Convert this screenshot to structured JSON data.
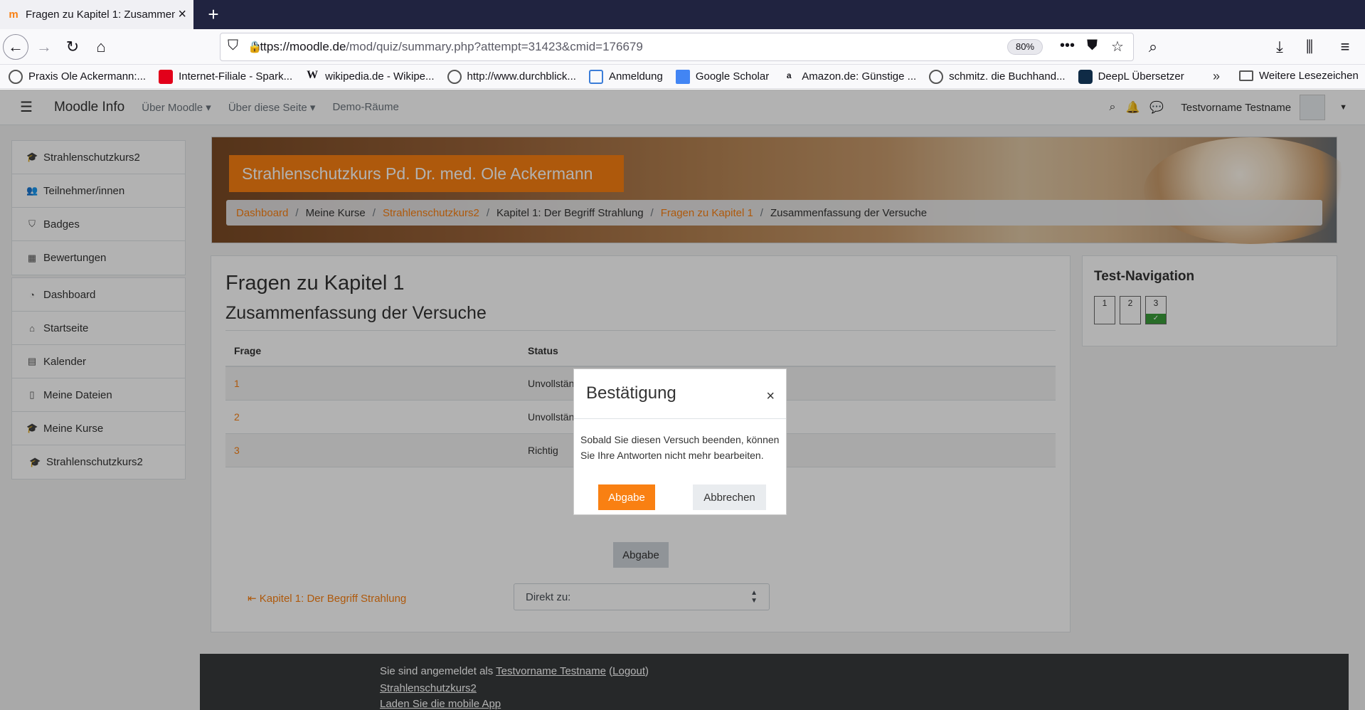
{
  "browser": {
    "tab_title": "Fragen zu Kapitel 1: Zusammen",
    "url_host": "https://moodle.de",
    "url_path": "/mod/quiz/summary.php?attempt=31423&cmid=176679",
    "zoom": "80%",
    "bookmarks": [
      "Praxis Ole Ackermann:...",
      "Internet-Filiale - Spark...",
      "wikipedia.de - Wikipe...",
      "http://www.durchblick...",
      "Anmeldung",
      "Google Scholar",
      "Amazon.de: Günstige ...",
      "schmitz. die Buchhand...",
      "DeepL Übersetzer"
    ],
    "bookmarks_other": "Weitere Lesezeichen"
  },
  "moodle_nav": {
    "brand": "Moodle Info",
    "menu": [
      "Über Moodle",
      "Über diese Seite",
      "Demo-Räume"
    ],
    "user": "Testvorname Testname"
  },
  "sidebar": {
    "block1": [
      "Strahlenschutzkurs2",
      "Teilnehmer/innen",
      "Badges",
      "Bewertungen"
    ],
    "block2": [
      "Dashboard",
      "Startseite",
      "Kalender",
      "Meine Dateien",
      "Meine Kurse",
      "Strahlenschutzkurs2"
    ]
  },
  "header": {
    "course_title": "Strahlenschutzkurs Pd. Dr. med. Ole Ackermann",
    "breadcrumb": [
      "Dashboard",
      "Meine Kurse",
      "Strahlenschutzkurs2",
      "Kapitel 1: Der Begriff Strahlung",
      "Fragen zu Kapitel 1",
      "Zusammenfassung der Versuche"
    ]
  },
  "main": {
    "title": "Fragen zu Kapitel 1",
    "subtitle": "Zusammenfassung der Versuche",
    "table_headers": [
      "Frage",
      "Status"
    ],
    "rows": [
      {
        "q": "1",
        "status": "Unvollständig"
      },
      {
        "q": "2",
        "status": "Unvollständig"
      },
      {
        "q": "3",
        "status": "Richtig"
      }
    ],
    "submit_label": "Abgabe",
    "prev_link": "Kapitel 1: Der Begriff Strahlung",
    "jump_placeholder": "Direkt zu:"
  },
  "quiz_nav": {
    "title": "Test-Navigation",
    "questions": [
      "1",
      "2",
      "3"
    ]
  },
  "footer": {
    "logged_in_prefix": "Sie sind angemeldet als",
    "user": "Testvorname Testname",
    "logout": "Logout",
    "course": "Strahlenschutzkurs2",
    "app": "Laden Sie die mobile App"
  },
  "modal": {
    "title": "Bestätigung",
    "body": "Sobald Sie diesen Versuch beenden, können Sie Ihre Antworten nicht mehr bearbeiten.",
    "submit": "Abgabe",
    "cancel": "Abbrechen"
  },
  "colors": {
    "accent": "#f98012",
    "browser_tabstrip": "#202340",
    "footer_bg": "#373a3c"
  }
}
